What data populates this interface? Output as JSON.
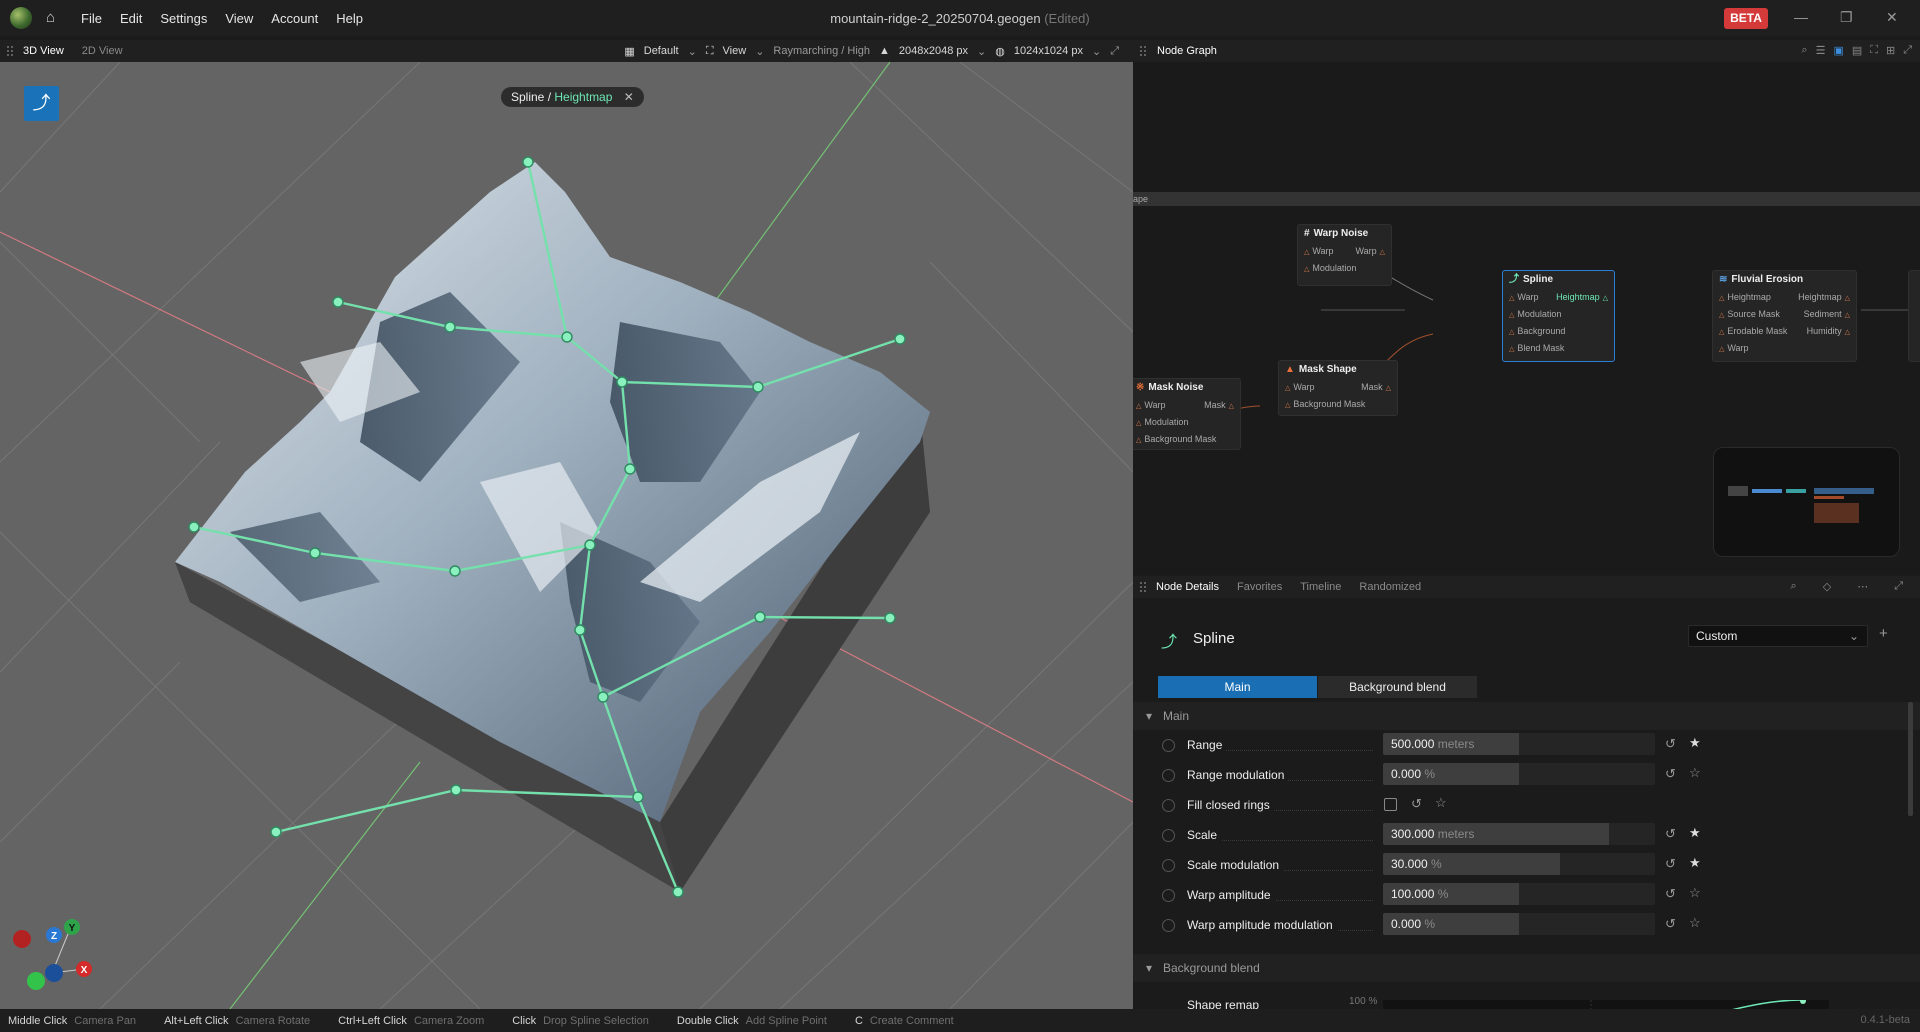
{
  "app": {
    "document_title": "mountain-ridge-2_20250704.geogen",
    "edited_label": "(Edited)",
    "beta_label": "BETA",
    "version": "0.4.1-beta"
  },
  "menu": [
    "File",
    "Edit",
    "Settings",
    "View",
    "Account",
    "Help"
  ],
  "viewport": {
    "tabs": [
      "3D View",
      "2D View"
    ],
    "toolbar": {
      "preset": "Default",
      "view": "View",
      "render_mode": "Raymarching / High",
      "build_resolution": "2048x2048 px",
      "preview_resolution": "1024x1024 px"
    },
    "breadcrumb": {
      "parent": "Spline",
      "separator": " / ",
      "current": "Heightmap"
    },
    "axes": [
      "Y",
      "Z",
      "X"
    ]
  },
  "node_graph": {
    "title": "Node Graph",
    "strip_label": "ape",
    "nodes": {
      "warp_noise": {
        "title": "Warp Noise",
        "warp_in": "Warp",
        "warp_out": "Warp",
        "modulation": "Modulation"
      },
      "spline": {
        "title": "Spline",
        "warp": "Warp",
        "out": "Heightmap",
        "modulation": "Modulation",
        "background": "Background",
        "blend_mask": "Blend Mask"
      },
      "fluvial": {
        "title": "Fluvial Erosion",
        "heightmap_in": "Heightmap",
        "heightmap_out": "Heightmap",
        "source_mask": "Source Mask",
        "sediment": "Sediment",
        "erodable_mask": "Erodable Mask",
        "humidity": "Humidity",
        "warp": "Warp"
      },
      "mask_shape": {
        "title": "Mask Shape",
        "warp": "Warp",
        "out": "Mask",
        "background_mask": "Background Mask"
      },
      "mask_noise": {
        "title": "Mask Noise",
        "warp": "Warp",
        "out": "Mask",
        "modulation": "Modulation",
        "background_mask": "Background Mask"
      }
    }
  },
  "details": {
    "tabs": [
      "Node Details",
      "Favorites",
      "Timeline",
      "Randomized"
    ],
    "node_title": "Spline",
    "preset": "Custom",
    "subtabs": [
      "Main",
      "Background blend"
    ],
    "section_main": "Main",
    "section_blend": "Background blend",
    "params": [
      {
        "label": "Range",
        "value": "500.000",
        "unit": "meters",
        "fill": 0.5,
        "fav": true
      },
      {
        "label": "Range modulation",
        "value": "0.000",
        "unit": "%",
        "fill": 0.5,
        "fav": false
      },
      {
        "label": "Fill closed rings",
        "value": "",
        "unit": "",
        "fill": 0,
        "fav": false
      },
      {
        "label": "Scale",
        "value": "300.000",
        "unit": "meters",
        "fill": 0.83,
        "fav": true
      },
      {
        "label": "Scale modulation",
        "value": "30.000",
        "unit": "%",
        "fill": 0.65,
        "fav": true
      },
      {
        "label": "Warp amplitude",
        "value": "100.000",
        "unit": "%",
        "fill": 0.5,
        "fav": false
      },
      {
        "label": "Warp amplitude modulation",
        "value": "0.000",
        "unit": "%",
        "fill": 0.5,
        "fav": false
      }
    ],
    "shape_remap": {
      "label": "Shape remap",
      "top_value": "100 %"
    }
  },
  "status_bar": [
    {
      "key": "Middle Click",
      "action": "Camera Pan"
    },
    {
      "key": "Alt+Left Click",
      "action": "Camera Rotate"
    },
    {
      "key": "Ctrl+Left Click",
      "action": "Camera Zoom"
    },
    {
      "key": "Click",
      "action": "Drop Spline Selection"
    },
    {
      "key": "Double Click",
      "action": "Add Spline Point"
    },
    {
      "key": "C",
      "action": "Create Comment"
    }
  ]
}
